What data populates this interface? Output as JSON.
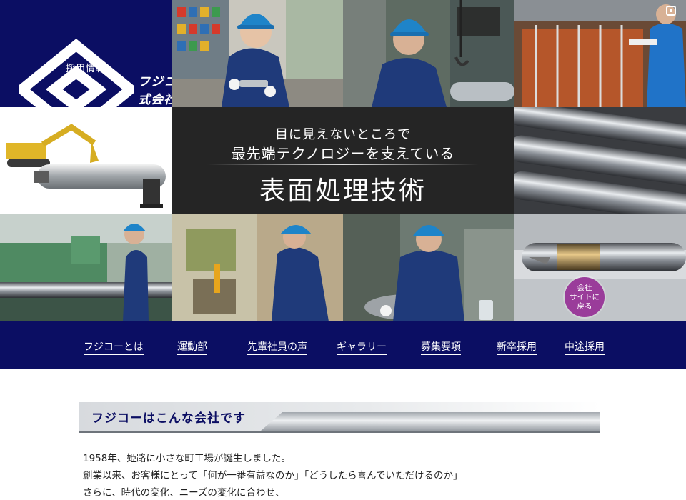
{
  "brand": {
    "logo_text": "フジコー株式会社",
    "recruit_label": "採用情報"
  },
  "hero": {
    "catch_line1": "目に見えないところで",
    "catch_line2": "最先端テクノロジーを支えている",
    "catch_line3": "表面処理技術",
    "corporate_site_button": [
      "会社",
      "サイトに",
      "戻る"
    ]
  },
  "nav": {
    "items": [
      {
        "label": "フジコーとは"
      },
      {
        "label": "運動部"
      },
      {
        "label": "先輩社員の声"
      },
      {
        "label": "ギャラリー"
      },
      {
        "label": "募集要項"
      },
      {
        "label": "新卒採用"
      },
      {
        "label": "中途採用"
      }
    ]
  },
  "about": {
    "heading": "フジコーはこんな会社です",
    "lines": [
      "1958年、姫路に小さな町工場が誕生しました。",
      "創業以来、お客様にとって「何が一番有益なのか」「どうしたら喜んでいただけるのか」",
      "さらに、時代の変化、ニーズの変化に合わせ、"
    ]
  },
  "colors": {
    "brand_navy": "#0b0e63",
    "catch_bg": "#252525",
    "corporate_button": "#9a3c9a"
  }
}
